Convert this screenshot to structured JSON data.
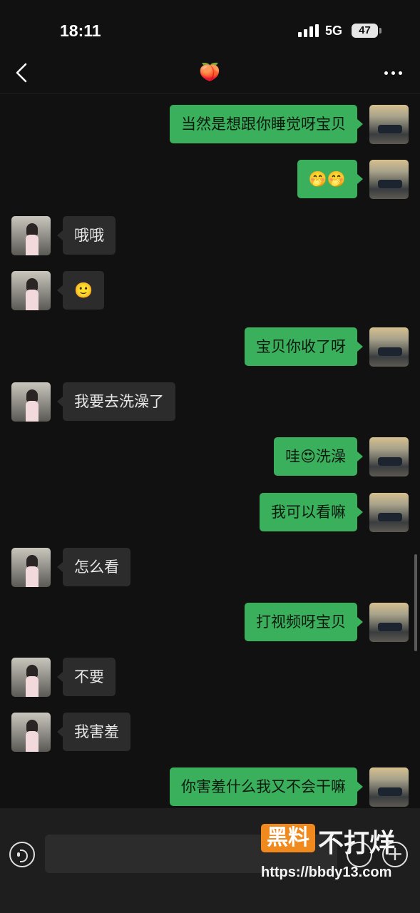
{
  "status_bar": {
    "time": "18:11",
    "network": "5G",
    "battery": "47"
  },
  "header": {
    "title_emoji": "🍑",
    "back_icon": "chevron-left-icon",
    "more_icon": "more-dots-icon"
  },
  "messages": [
    {
      "direction": "out",
      "text": "当然是想跟你睡觉呀宝贝"
    },
    {
      "direction": "out",
      "text": "🤭🤭"
    },
    {
      "direction": "in",
      "text": "哦哦"
    },
    {
      "direction": "in",
      "text": "🙂"
    },
    {
      "direction": "out",
      "text": "宝贝你收了呀"
    },
    {
      "direction": "in",
      "text": "我要去洗澡了"
    },
    {
      "direction": "out",
      "text": "哇😍洗澡"
    },
    {
      "direction": "out",
      "text": "我可以看嘛"
    },
    {
      "direction": "in",
      "text": "怎么看"
    },
    {
      "direction": "out",
      "text": "打视频呀宝贝"
    },
    {
      "direction": "in",
      "text": "不要"
    },
    {
      "direction": "in",
      "text": "我害羞"
    },
    {
      "direction": "out",
      "text": "你害羞什么我又不会干嘛"
    },
    {
      "direction": "out",
      "text": ""
    }
  ],
  "input_bar": {
    "input_value": "",
    "plus_label": "+"
  },
  "watermark": {
    "badge": "黑料",
    "text": "不打烊",
    "url": "https://bbdy13.com"
  },
  "colors": {
    "outgoing_bubble": "#3bb05c",
    "incoming_bubble": "#2c2c2c",
    "background": "#111111",
    "watermark_badge": "#f08a1e"
  }
}
